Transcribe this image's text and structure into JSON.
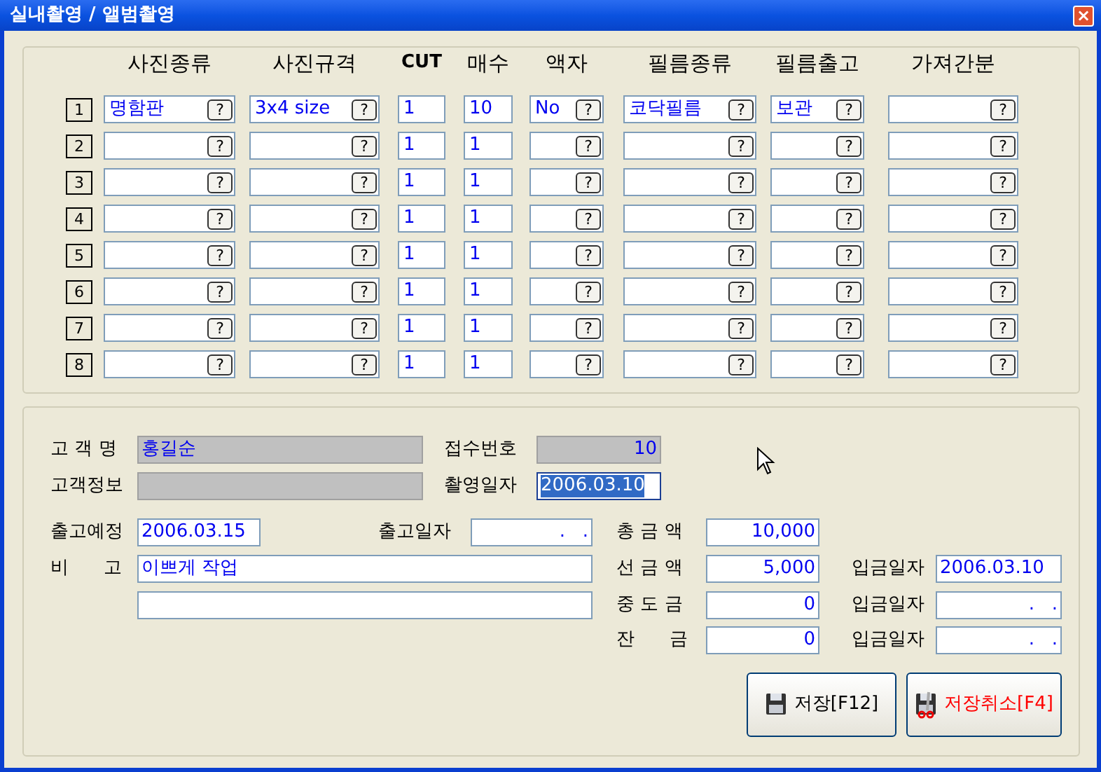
{
  "window": {
    "title": "실내촬영 / 앨범촬영",
    "close": "×"
  },
  "columns": [
    {
      "label": "사진종류",
      "kind": "lookup"
    },
    {
      "label": "사진규격",
      "kind": "lookup"
    },
    {
      "label": "CUT",
      "kind": "plain"
    },
    {
      "label": "매수",
      "kind": "plain"
    },
    {
      "label": "액자",
      "kind": "lookup"
    },
    {
      "label": "필름종류",
      "kind": "lookup"
    },
    {
      "label": "필름출고",
      "kind": "lookup"
    },
    {
      "label": "가져간분",
      "kind": "lookup"
    }
  ],
  "rows": [
    {
      "number": "1",
      "cells": [
        {
          "value": "명함판",
          "button": "?"
        },
        {
          "value": "3x4 size",
          "button": "?"
        },
        {
          "value": "1"
        },
        {
          "value": "10"
        },
        {
          "value": "No",
          "button": "?"
        },
        {
          "value": "코닥필름",
          "button": "?"
        },
        {
          "value": "보관",
          "button": "?"
        },
        {
          "button": "?"
        }
      ]
    },
    {
      "number": "2",
      "cells": [
        {
          "button": "?"
        },
        {
          "button": "?"
        },
        {
          "value": "1"
        },
        {
          "value": "1"
        },
        {
          "button": "?"
        },
        {
          "button": "?"
        },
        {
          "button": "?"
        },
        {
          "button": "?"
        }
      ]
    },
    {
      "number": "3",
      "cells": [
        {
          "button": "?"
        },
        {
          "button": "?"
        },
        {
          "value": "1"
        },
        {
          "value": "1"
        },
        {
          "button": "?"
        },
        {
          "button": "?"
        },
        {
          "button": "?"
        },
        {
          "button": "?"
        }
      ]
    },
    {
      "number": "4",
      "cells": [
        {
          "button": "?"
        },
        {
          "button": "?"
        },
        {
          "value": "1"
        },
        {
          "value": "1"
        },
        {
          "button": "?"
        },
        {
          "button": "?"
        },
        {
          "button": "?"
        },
        {
          "button": "?"
        }
      ]
    },
    {
      "number": "5",
      "cells": [
        {
          "button": "?"
        },
        {
          "button": "?"
        },
        {
          "value": "1"
        },
        {
          "value": "1"
        },
        {
          "button": "?"
        },
        {
          "button": "?"
        },
        {
          "button": "?"
        },
        {
          "button": "?"
        }
      ]
    },
    {
      "number": "6",
      "cells": [
        {
          "button": "?"
        },
        {
          "button": "?"
        },
        {
          "value": "1"
        },
        {
          "value": "1"
        },
        {
          "button": "?"
        },
        {
          "button": "?"
        },
        {
          "button": "?"
        },
        {
          "button": "?"
        }
      ]
    },
    {
      "number": "7",
      "cells": [
        {
          "button": "?"
        },
        {
          "button": "?"
        },
        {
          "value": "1"
        },
        {
          "value": "1"
        },
        {
          "button": "?"
        },
        {
          "button": "?"
        },
        {
          "button": "?"
        },
        {
          "button": "?"
        }
      ]
    },
    {
      "number": "8",
      "cells": [
        {
          "button": "?"
        },
        {
          "button": "?"
        },
        {
          "value": "1"
        },
        {
          "value": "1"
        },
        {
          "button": "?"
        },
        {
          "button": "?"
        },
        {
          "button": "?"
        },
        {
          "button": "?"
        }
      ]
    }
  ],
  "form_rows": [
    [
      {
        "kind": "label",
        "text": "고 객 명"
      },
      {
        "kind": "field",
        "value": "홍길순",
        "readonly": true,
        "selected": false
      },
      {
        "kind": "label",
        "text": "접수번호"
      },
      {
        "kind": "field",
        "value": "10",
        "readonly": true,
        "selected": false
      }
    ],
    [
      {
        "kind": "label",
        "text": "고객정보"
      },
      {
        "kind": "field",
        "readonly": true,
        "selected": false
      },
      {
        "kind": "label",
        "text": "촬영일자"
      },
      {
        "kind": "field",
        "value": "2006.03.10",
        "readonly": false,
        "selected": true
      }
    ],
    [
      {
        "kind": "label",
        "text": "출고예정"
      },
      {
        "kind": "field",
        "value": "2006.03.15",
        "readonly": false,
        "selected": false
      },
      {
        "kind": "label",
        "text": "출고일자"
      },
      {
        "kind": "field",
        "value": ".   .",
        "readonly": false,
        "selected": false
      },
      {
        "kind": "label",
        "text": "총 금 액"
      },
      {
        "kind": "field",
        "value": "10,000",
        "readonly": false,
        "selected": false
      }
    ],
    [
      {
        "kind": "label",
        "text": "비      고"
      },
      {
        "kind": "field",
        "value": "이쁘게 작업",
        "readonly": false,
        "selected": false
      },
      {
        "kind": "label",
        "text": "선 금 액"
      },
      {
        "kind": "field",
        "value": "5,000",
        "readonly": false,
        "selected": false
      },
      {
        "kind": "label",
        "text": "입금일자"
      },
      {
        "kind": "field",
        "value": "2006.03.10",
        "readonly": false,
        "selected": false
      }
    ],
    [
      {
        "kind": "field",
        "readonly": false,
        "selected": false
      },
      {
        "kind": "label",
        "text": "중 도 금"
      },
      {
        "kind": "field",
        "value": "0",
        "readonly": false,
        "selected": false
      },
      {
        "kind": "label",
        "text": "입금일자"
      },
      {
        "kind": "field",
        "value": ".   .",
        "readonly": false,
        "selected": false
      }
    ],
    [
      {
        "kind": "label",
        "text": "잔      금"
      },
      {
        "kind": "field",
        "value": "0",
        "readonly": false,
        "selected": false
      },
      {
        "kind": "label",
        "text": "입금일자"
      },
      {
        "kind": "field",
        "value": ".   .",
        "readonly": false,
        "selected": false
      }
    ]
  ],
  "buttons": [
    {
      "label": "저장[F12]",
      "kind": "save"
    },
    {
      "label": "저장취소[F4]",
      "kind": "cancel"
    }
  ]
}
